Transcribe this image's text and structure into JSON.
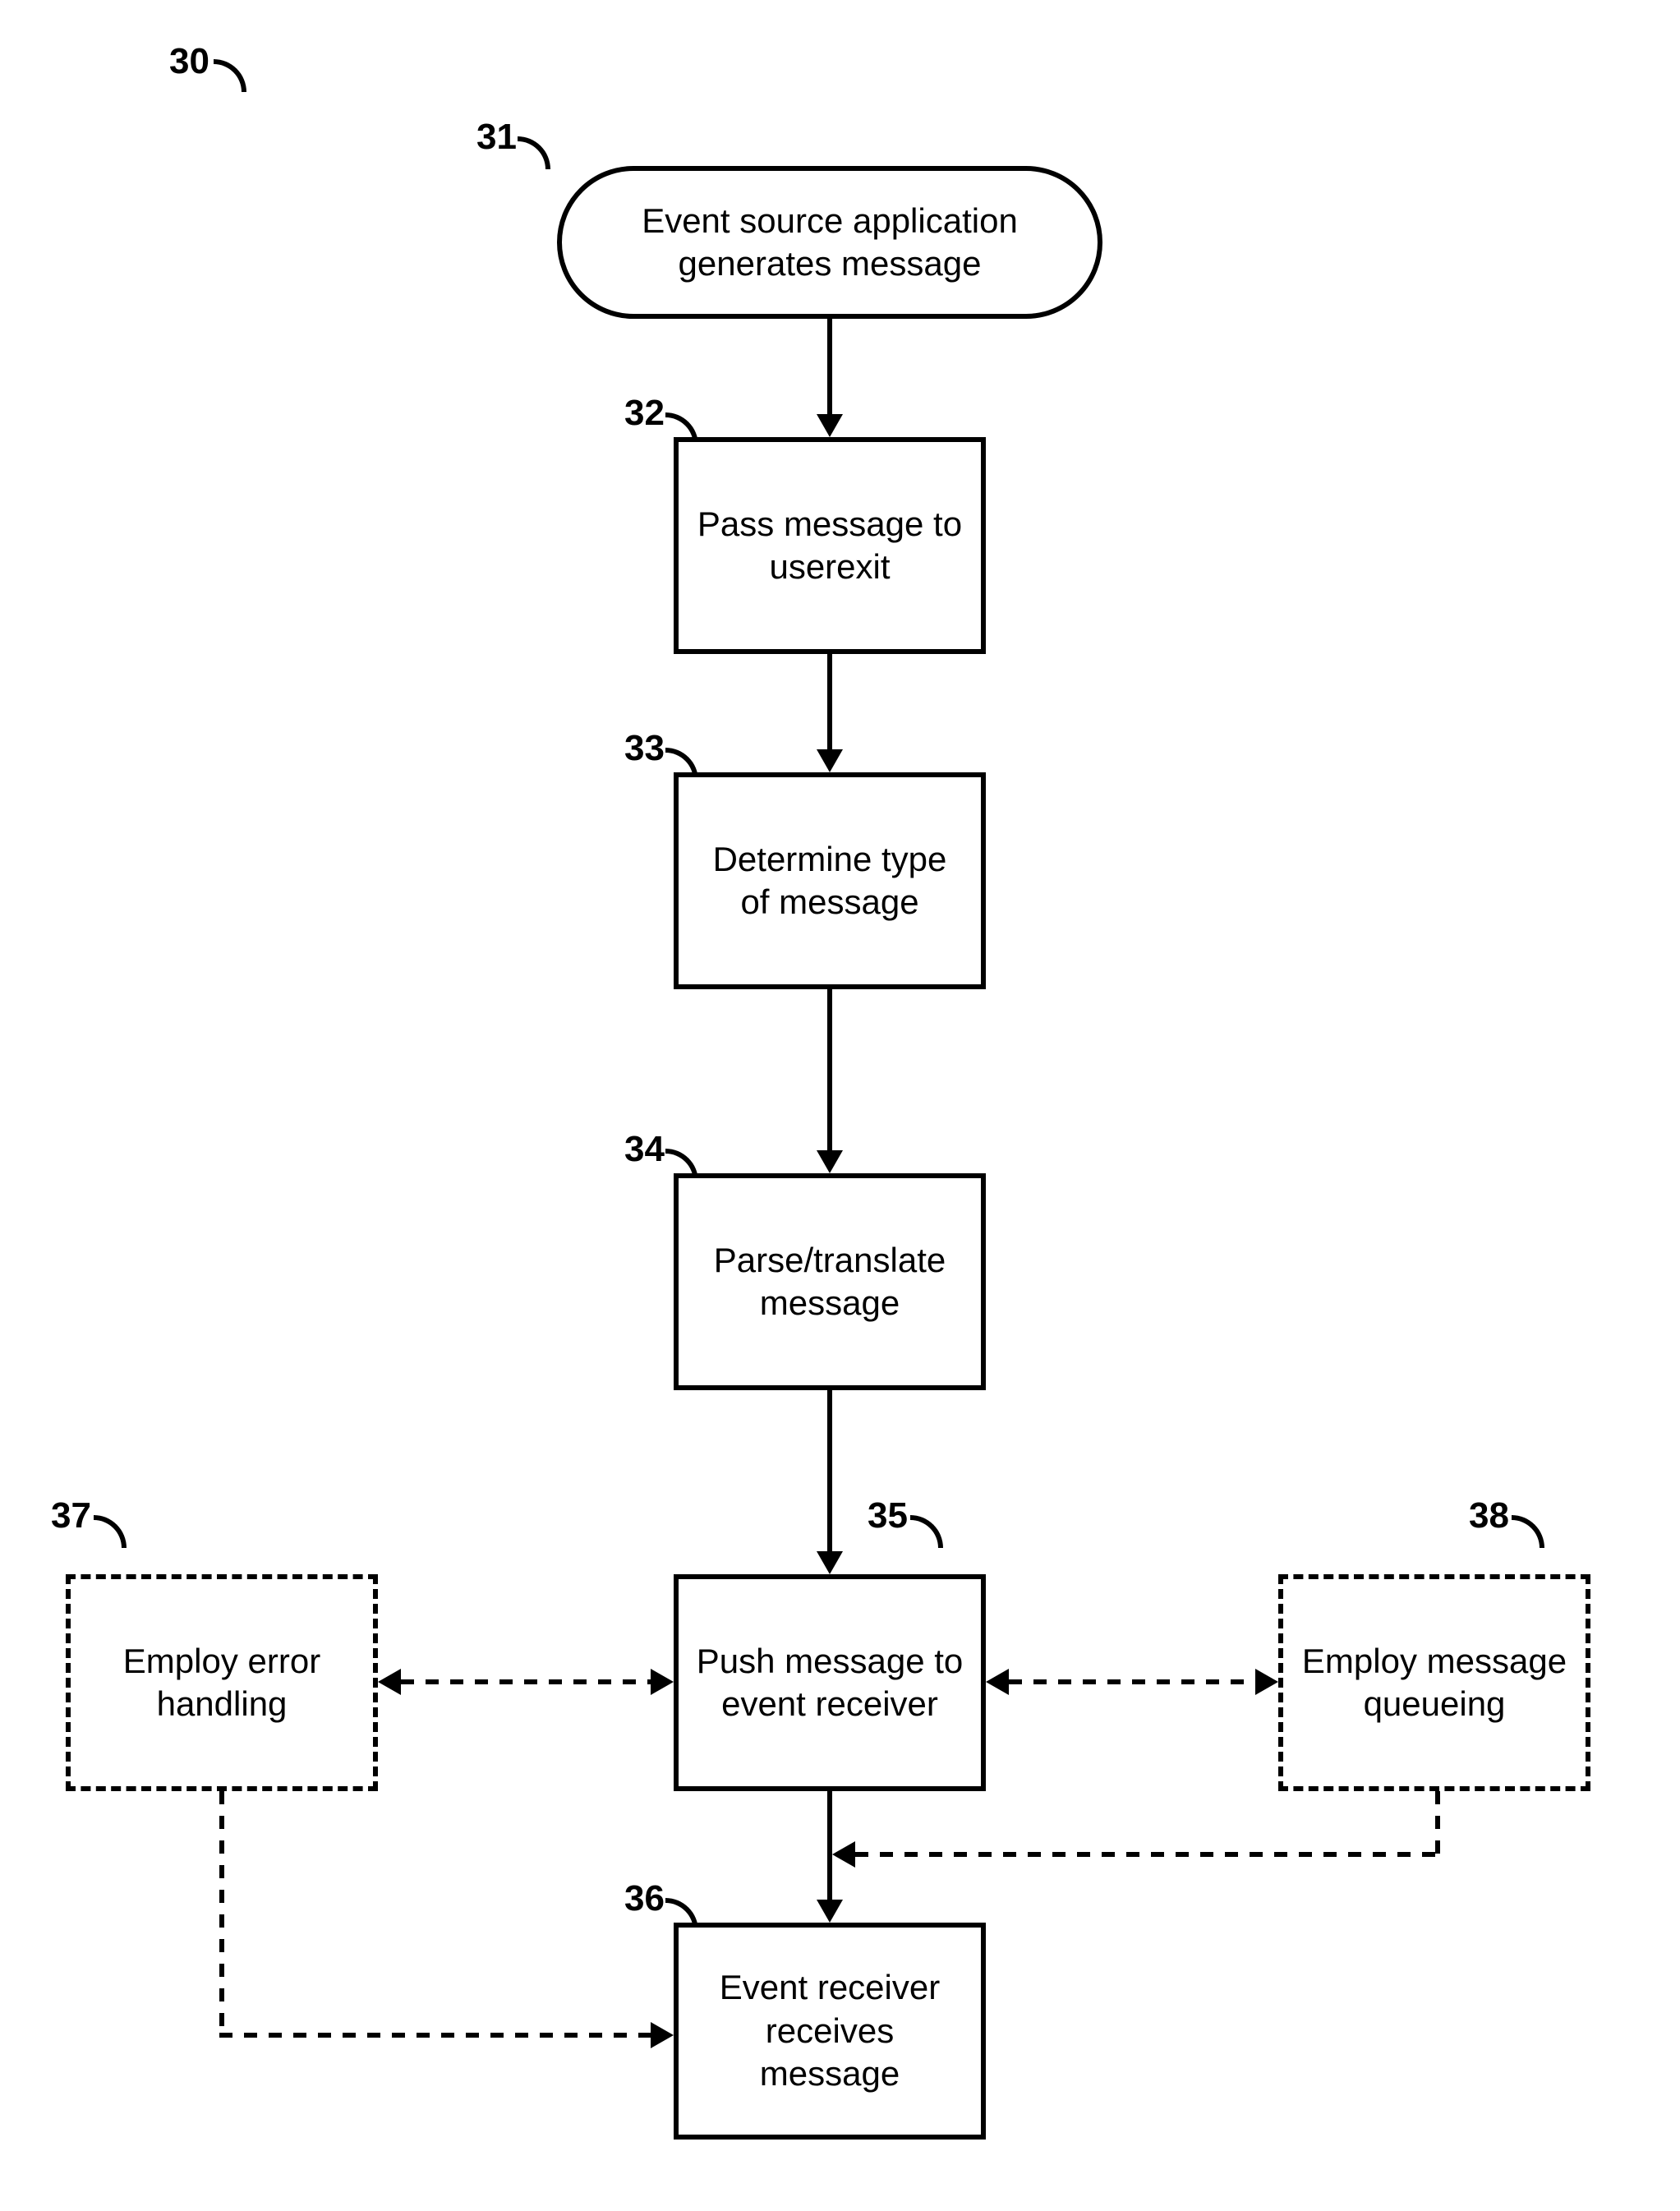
{
  "flowchart": {
    "figure_label": "30",
    "nodes": {
      "n31": {
        "id": "31",
        "text": "Event source application generates message",
        "shape": "stadium"
      },
      "n32": {
        "id": "32",
        "text": "Pass message to userexit",
        "shape": "rect"
      },
      "n33": {
        "id": "33",
        "text": "Determine type of message",
        "shape": "rect"
      },
      "n34": {
        "id": "34",
        "text": "Parse/translate message",
        "shape": "rect"
      },
      "n35": {
        "id": "35",
        "text": "Push message to event receiver",
        "shape": "rect"
      },
      "n36": {
        "id": "36",
        "text": "Event receiver receives message",
        "shape": "rect"
      },
      "n37": {
        "id": "37",
        "text": "Employ error handling",
        "shape": "dashed"
      },
      "n38": {
        "id": "38",
        "text": "Employ message queueing",
        "shape": "dashed"
      }
    },
    "edges": [
      {
        "from": "n31",
        "to": "n32",
        "style": "solid",
        "dir": "forward"
      },
      {
        "from": "n32",
        "to": "n33",
        "style": "solid",
        "dir": "forward"
      },
      {
        "from": "n33",
        "to": "n34",
        "style": "solid",
        "dir": "forward"
      },
      {
        "from": "n34",
        "to": "n35",
        "style": "solid",
        "dir": "forward"
      },
      {
        "from": "n35",
        "to": "n36",
        "style": "solid",
        "dir": "forward"
      },
      {
        "from": "n35",
        "to": "n37",
        "style": "dashed",
        "dir": "both"
      },
      {
        "from": "n35",
        "to": "n38",
        "style": "dashed",
        "dir": "both"
      },
      {
        "from": "n37",
        "to": "n36",
        "style": "dashed",
        "dir": "forward"
      },
      {
        "from": "n38",
        "to": "n36",
        "style": "dashed",
        "dir": "forward"
      }
    ]
  }
}
